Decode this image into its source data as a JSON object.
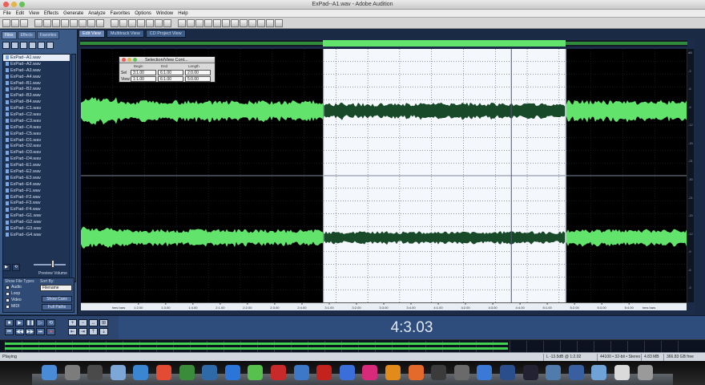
{
  "window": {
    "title": "ExPad--A1.wav - Adobe Audition"
  },
  "menu": [
    "File",
    "Edit",
    "View",
    "Effects",
    "Generate",
    "Analyze",
    "Favorites",
    "Options",
    "Window",
    "Help"
  ],
  "left_panel": {
    "tabs": [
      "Files",
      "Effects",
      "Favorites"
    ],
    "files": [
      "ExPad--A1.wav",
      "ExPad--A2.wav",
      "ExPad--A3.wav",
      "ExPad--A4.wav",
      "ExPad--B1.wav",
      "ExPad--B2.wav",
      "ExPad--B3.wav",
      "ExPad--B4.wav",
      "ExPad--C1.wav",
      "ExPad--C2.wav",
      "ExPad--C3.wav",
      "ExPad--C4.wav",
      "ExPad--C5.wav",
      "ExPad--D1.wav",
      "ExPad--D2.wav",
      "ExPad--D3.wav",
      "ExPad--D4.wav",
      "ExPad--E1.wav",
      "ExPad--E2.wav",
      "ExPad--E3.wav",
      "ExPad--E4.wav",
      "ExPad--F1.wav",
      "ExPad--F2.wav",
      "ExPad--F3.wav",
      "ExPad--F4.wav",
      "ExPad--G1.wav",
      "ExPad--G2.wav",
      "ExPad--G3.wav",
      "ExPad--G4.wav"
    ],
    "preview_volume_label": "Preview Volume",
    "show_file_types_label": "Show File Types",
    "sort_by_label": "Sort By:",
    "sort_by_value": "Filename",
    "file_types": [
      "Audio",
      "Loop",
      "Video",
      "MIDI"
    ],
    "show_cues_label": "Show Cues",
    "full_paths_label": "Full Paths"
  },
  "view_tabs": [
    "Edit View",
    "Multitrack View",
    "CD Project View"
  ],
  "selection_view_controls": {
    "title": "Selection/View Cont...",
    "columns": [
      "Begin",
      "End",
      "Length"
    ],
    "rows": [
      {
        "label": "Sel",
        "begin": "3:1.00",
        "end": "6:1.00",
        "length": "2:0.00"
      },
      {
        "label": "View",
        "begin": "1:1.00",
        "end": "6:1.00",
        "length": "5:0.00"
      }
    ]
  },
  "ruler": {
    "start_label": "hms bars",
    "end_label": "hms bars",
    "ticks": [
      "1:2.00",
      "1:3.00",
      "1:4.00",
      "2:1.00",
      "2:2.00",
      "2:3.00",
      "2:4.00",
      "3:1.00",
      "3:2.00",
      "3:3.00",
      "3:4.00",
      "4:1.00",
      "4:2.00",
      "4:3.00",
      "4:4.00",
      "5:1.00",
      "5:2.00",
      "5:3.00",
      "5:4.00"
    ]
  },
  "amplitude_scale": [
    "dB",
    "-3",
    "-6",
    "-9",
    "-12",
    "-15",
    "-21",
    "-30",
    "-21",
    "-15",
    "-12",
    "-9",
    "-6",
    "-3"
  ],
  "transport": {
    "play_icon": "play-icon",
    "stop_icon": "stop-icon",
    "pause_icon": "pause-icon",
    "record_icon": "record-icon",
    "loop_icon": "loop-icon"
  },
  "time_display": "4:3.03",
  "status": {
    "left": "Playing",
    "level": "L -13.5dB @ 1:2.02",
    "format": "44100 • 32-bit • Stereo",
    "size": "4.83 MB",
    "free": "366.83 GB free"
  },
  "selection_fraction": {
    "start": 0.4,
    "end": 0.8
  },
  "playhead_fraction": 0.71,
  "level_meter_fraction": 0.73,
  "colors": {
    "waveform": "#62e36c",
    "waveform_selected": "#184a2a",
    "selection_bg": "#f4f7fb",
    "background": "#000000"
  },
  "dock_icons": [
    "finder-icon",
    "launchpad-icon",
    "photo-booth-icon",
    "preview-icon",
    "safari-icon",
    "chrome-icon",
    "evernote-icon",
    "camera-icon",
    "dropbox-icon",
    "spotify-icon",
    "filezilla-icon",
    "fetch-icon",
    "acrobat-icon",
    "itunes-icon",
    "audacity-icon",
    "rewind-icon",
    "cd-icon",
    "rx-icon",
    "cut-icon",
    "vnc-icon",
    "wifi-icon",
    "dvd-icon",
    "image-icon",
    "quicktime-icon",
    "folder-icon",
    "documents-icon",
    "trash-icon"
  ]
}
